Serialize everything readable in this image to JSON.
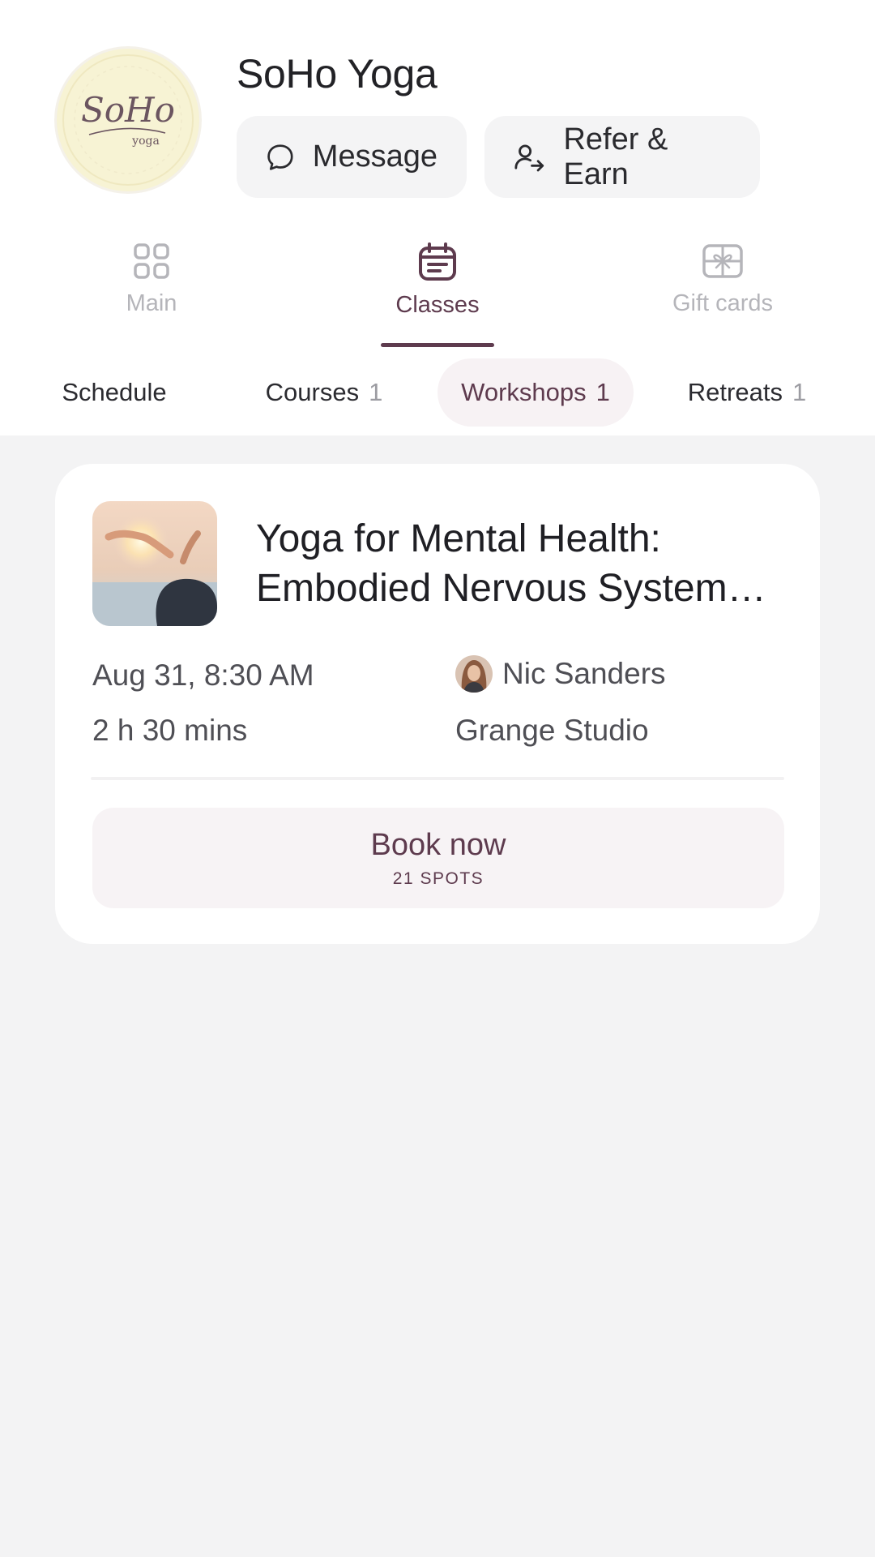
{
  "studio": {
    "name": "SoHo Yoga",
    "logo_text": "SoHo",
    "logo_subtext": "yoga"
  },
  "actions": {
    "message_label": "Message",
    "refer_label": "Refer & Earn"
  },
  "nav": {
    "tabs": [
      {
        "label": "Main",
        "icon": "grid-icon",
        "active": false
      },
      {
        "label": "Classes",
        "icon": "calendar-icon",
        "active": true
      },
      {
        "label": "Gift cards",
        "icon": "gift-card-icon",
        "active": false
      }
    ]
  },
  "subtabs": [
    {
      "label": "Schedule",
      "count": ""
    },
    {
      "label": "Courses",
      "count": "1"
    },
    {
      "label": "Workshops",
      "count": "1",
      "active": true
    },
    {
      "label": "Retreats",
      "count": "1"
    }
  ],
  "event": {
    "title_line1": "Yoga for Mental Health:",
    "title_line2": "Embodied Nervous System…",
    "datetime": "Aug 31, 8:30 AM",
    "duration": "2 h 30 mins",
    "instructor": "Nic Sanders",
    "location": "Grange Studio",
    "book_label": "Book now",
    "spots_label": "21 SPOTS"
  },
  "colors": {
    "accent": "#5e3b4e",
    "background": "#f3f3f4",
    "pill": "#f4f4f5",
    "logo_bg": "#f7f3d4"
  }
}
